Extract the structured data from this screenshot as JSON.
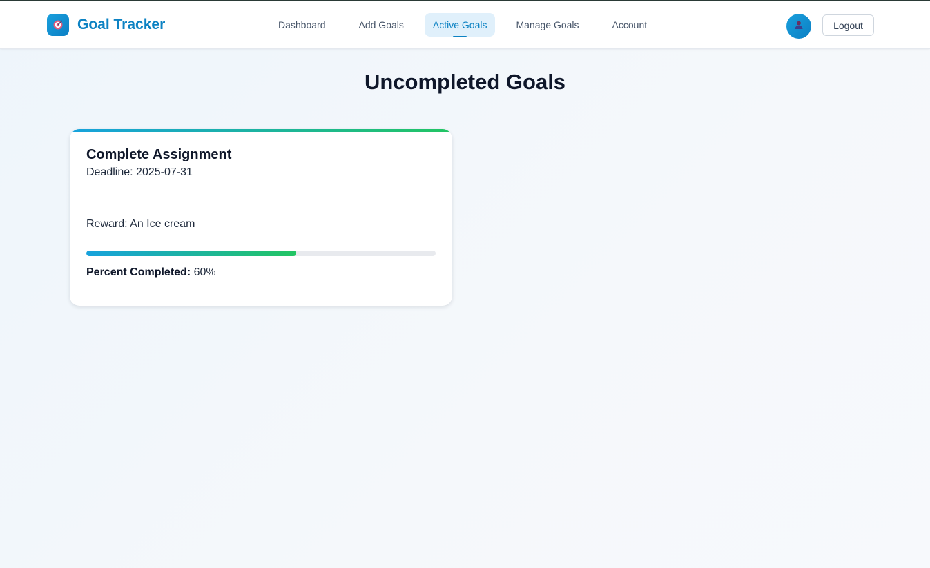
{
  "app": {
    "title": "Goal Tracker",
    "logo_icon": "target-icon",
    "brand_color": "#0c82c3"
  },
  "nav": {
    "items": [
      {
        "label": "Dashboard",
        "active": false
      },
      {
        "label": "Add Goals",
        "active": false
      },
      {
        "label": "Active Goals",
        "active": true
      },
      {
        "label": "Manage Goals",
        "active": false
      },
      {
        "label": "Account",
        "active": false
      }
    ]
  },
  "user": {
    "avatar_icon": "user-icon",
    "logout_label": "Logout"
  },
  "main": {
    "heading": "Uncompleted Goals",
    "goals": [
      {
        "title": "Complete Assignment",
        "deadline_text": "Deadline: 2025-07-31",
        "reward_text": "Reward: An Ice cream",
        "percent_label": "Percent Completed:",
        "percent_value": "60%",
        "progress": 0.6
      }
    ]
  },
  "colors": {
    "progress_start": "#17a2dd",
    "progress_end": "#22c563",
    "active_nav_bg": "#e0f0fb"
  }
}
